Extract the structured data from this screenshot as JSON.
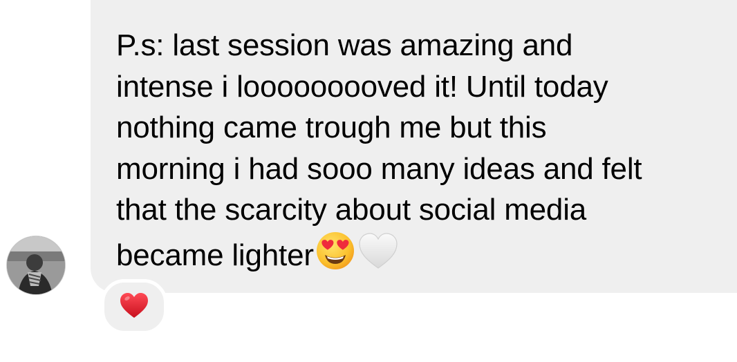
{
  "message": {
    "lines": [
      "P.s: last session was amazing and",
      "intense i looooooooved it! Until today",
      "nothing came trough me but this",
      "morning i had sooo many ideas and felt",
      "that the scarcity about social media",
      "became lighter"
    ],
    "emojis": [
      "heart-eyes-emoji",
      "white-heart-emoji"
    ],
    "bubble_color": "#efefef"
  },
  "reaction": {
    "emoji": "red-heart-emoji",
    "color": "#e0212f"
  }
}
